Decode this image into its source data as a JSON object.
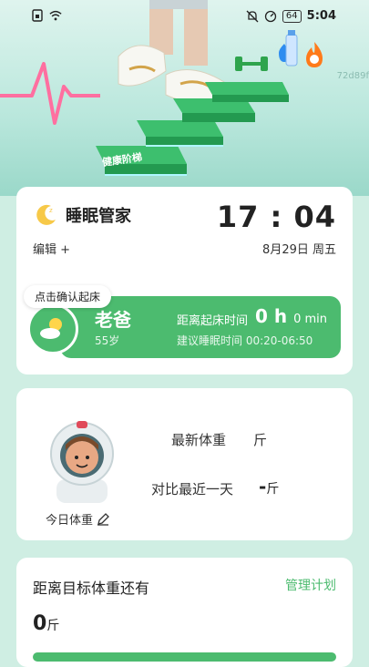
{
  "status_bar": {
    "time": "5:04",
    "battery": "64",
    "left_icons": [
      "sim-icon",
      "wifi-icon"
    ],
    "right_icons": [
      "bell-off-icon",
      "speedometer-icon",
      "battery-icon"
    ]
  },
  "banner": {
    "stairs_label": "健康阶梯",
    "watermark": "72d89f"
  },
  "sleep": {
    "title": "睡眠管家",
    "clock": "17 : 04",
    "edit_label": "编辑 +",
    "date": "8月29日 周五",
    "confirm_bubble": "点击确认起床",
    "person_name": "老爸",
    "person_age": "55岁",
    "wake_label": "距离起床时间",
    "wake_hours": "0 h",
    "wake_minutes": "0 min",
    "suggest_sleep": "建议睡眠时间 00:20-06:50"
  },
  "weight": {
    "today_label": "今日体重",
    "latest_label": "最新体重",
    "latest_unit": "斤",
    "compare_label": "对比最近一天",
    "compare_value": "-",
    "compare_unit": "斤"
  },
  "goal": {
    "title": "距离目标体重还有",
    "manage_link": "管理计划",
    "value": "0",
    "unit": "斤"
  },
  "colors": {
    "accent": "#4cbb6f",
    "background": "#cfeee3"
  }
}
